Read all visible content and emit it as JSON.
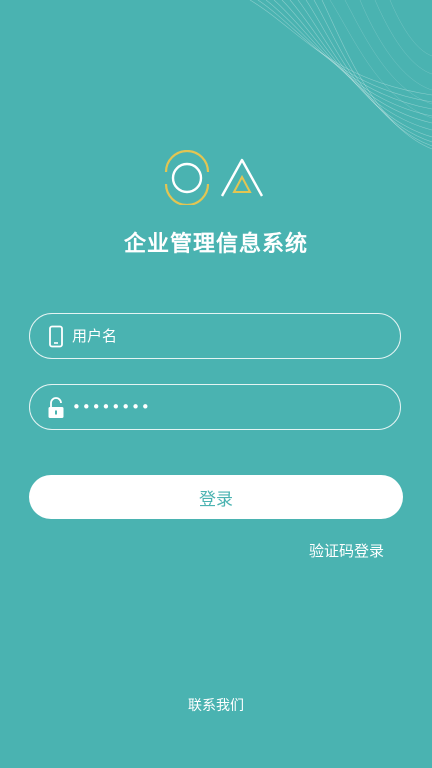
{
  "app": {
    "title": "企业管理信息系统",
    "logo_icon": "oa-logo-icon"
  },
  "form": {
    "username": {
      "placeholder": "用户名",
      "value": "",
      "icon": "phone-icon"
    },
    "password": {
      "value": "••••••••",
      "icon": "lock-icon"
    }
  },
  "actions": {
    "login_label": "登录",
    "sms_login_label": "验证码登录"
  },
  "footer": {
    "contact_label": "联系我们"
  },
  "colors": {
    "background": "#4ab3b1",
    "accent_yellow": "#e3c552",
    "button_text": "#4ab3b1"
  }
}
